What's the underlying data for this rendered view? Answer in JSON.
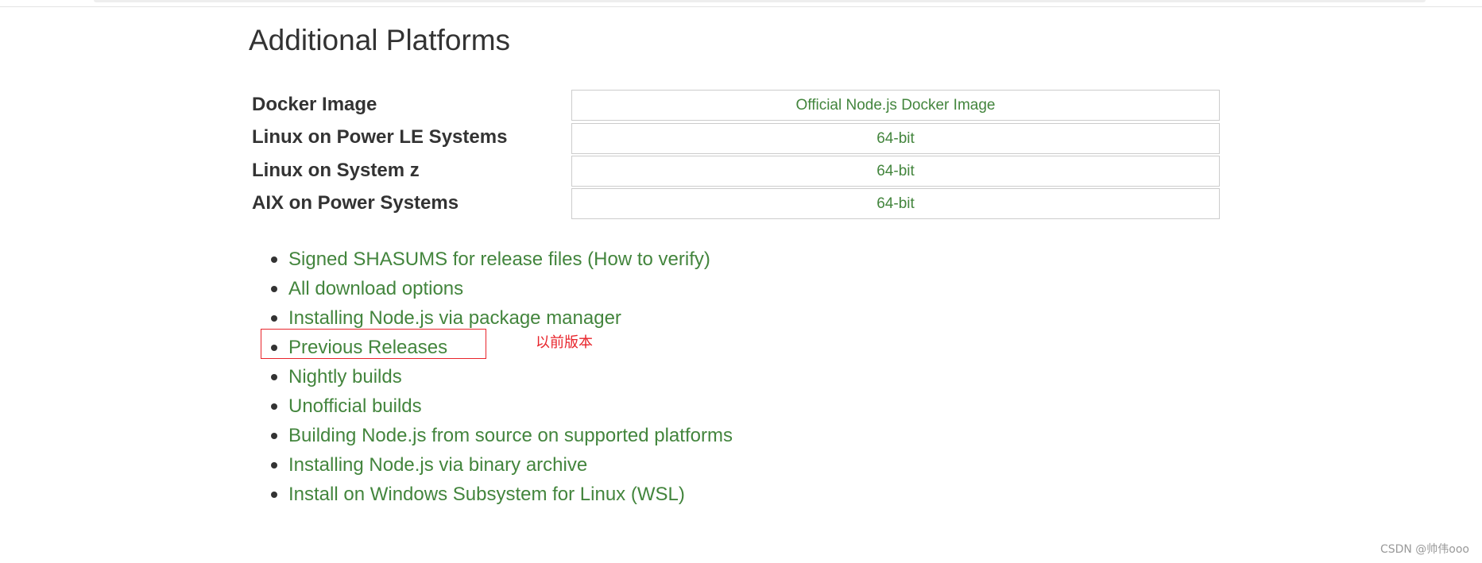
{
  "section": {
    "title": "Additional Platforms"
  },
  "platforms": [
    {
      "label": "Docker Image",
      "button": "Official Node.js Docker Image"
    },
    {
      "label": "Linux on Power LE Systems",
      "button": "64-bit"
    },
    {
      "label": "Linux on System z",
      "button": "64-bit"
    },
    {
      "label": "AIX on Power Systems",
      "button": "64-bit"
    }
  ],
  "links": [
    "Signed SHASUMS for release files (How to verify)",
    "All download options",
    "Installing Node.js via package manager",
    "Previous Releases",
    "Nightly builds",
    "Unofficial builds",
    "Building Node.js from source on supported platforms",
    "Installing Node.js via binary archive",
    "Install on Windows Subsystem for Linux (WSL)"
  ],
  "annotation": {
    "text": "以前版本"
  },
  "watermark": {
    "text": "CSDN @帅伟ooo"
  },
  "colors": {
    "link": "#43853d",
    "annotation": "#e8242b",
    "text": "#333333"
  }
}
